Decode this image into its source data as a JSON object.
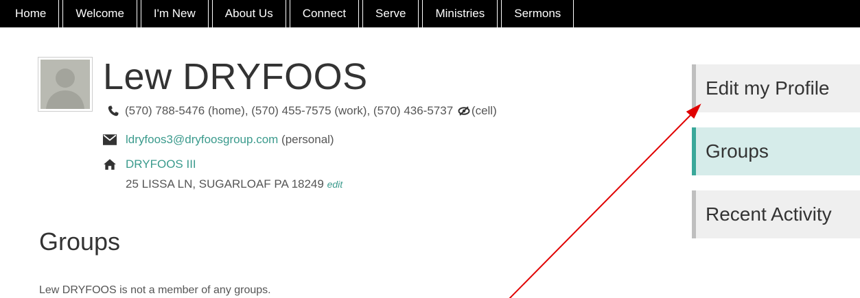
{
  "nav": {
    "tabs": [
      {
        "label": "Home"
      },
      {
        "label": "Welcome"
      },
      {
        "label": "I'm New"
      },
      {
        "label": "About Us"
      },
      {
        "label": "Connect"
      },
      {
        "label": "Serve"
      },
      {
        "label": "Ministries"
      },
      {
        "label": "Sermons"
      }
    ]
  },
  "profile": {
    "name": "Lew DRYFOOS",
    "phone_before_hidden": "(570) 788-5476 (home), (570) 455-7575 (work), (570) 436-5737",
    "phone_after_hidden": "(cell)",
    "email": "ldryfoos3@dryfoosgroup.com",
    "email_type": "(personal)",
    "family_name": "DRYFOOS III",
    "address": "25 LISSA LN, SUGARLOAF PA 18249",
    "edit_label": "edit"
  },
  "groups": {
    "heading": "Groups",
    "message": "Lew DRYFOOS is not a member of any groups."
  },
  "sidebar": {
    "items": [
      {
        "label": "Edit my Profile"
      },
      {
        "label": "Groups"
      },
      {
        "label": "Recent Activity"
      }
    ]
  },
  "colors": {
    "nav_bg": "#000000",
    "link": "#3a9a8c",
    "active_tab_bg": "#d6ecea",
    "active_tab_border": "#3aa89a",
    "annotation_arrow": "#e00000"
  },
  "icons": {
    "phone": "phone-icon",
    "email": "envelope-icon",
    "home": "home-icon",
    "hidden": "eye-slash-icon",
    "avatar": "default-avatar"
  }
}
